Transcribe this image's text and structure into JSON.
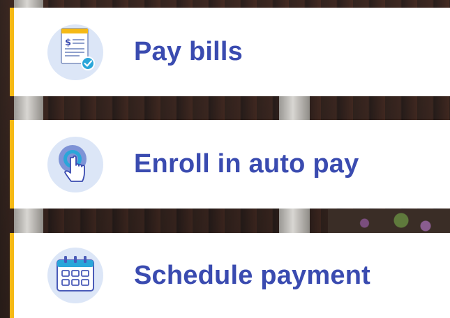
{
  "menu": {
    "items": [
      {
        "label": "Pay bills",
        "icon": "bill-document-icon"
      },
      {
        "label": "Enroll in auto pay",
        "icon": "tap-finger-icon"
      },
      {
        "label": "Schedule payment",
        "icon": "calendar-icon"
      }
    ]
  },
  "colors": {
    "accent_bar": "#f5b914",
    "label_text": "#3a4bb0",
    "icon_circle": "#dce6f7"
  }
}
